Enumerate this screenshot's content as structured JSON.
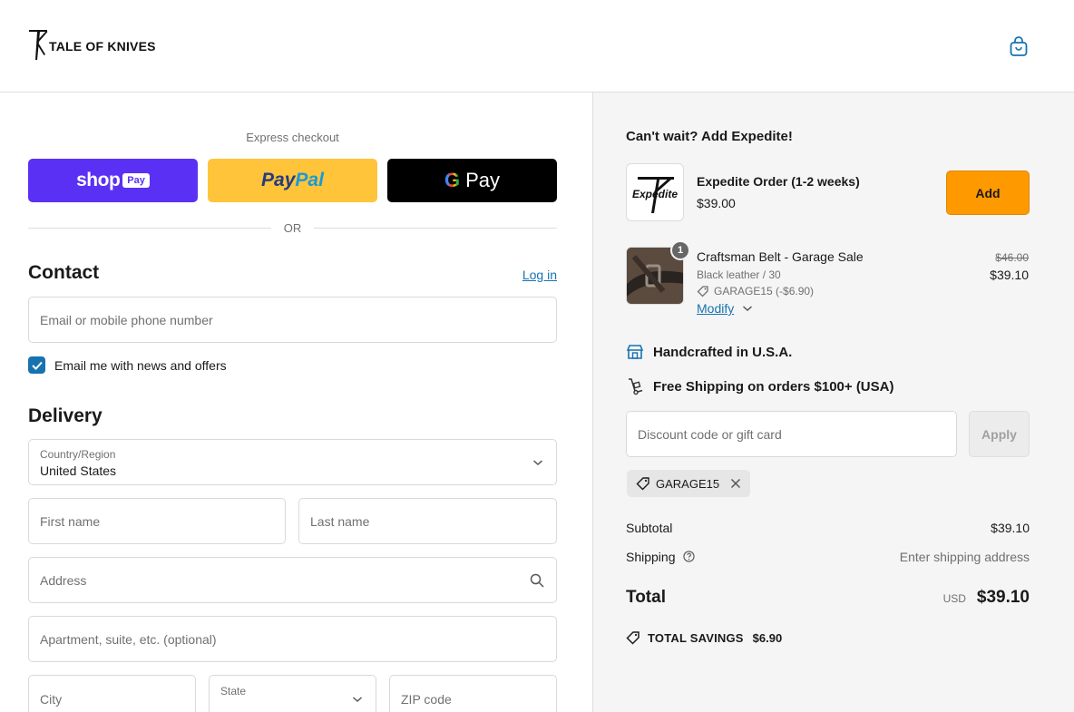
{
  "brand": {
    "name": "TALE OF KNIVES"
  },
  "header": {
    "cart_icon": "shopping-bag-icon"
  },
  "express": {
    "label": "Express checkout",
    "shop_word": "shop",
    "shop_pay": "Pay",
    "paypal_1": "Pay",
    "paypal_2": "Pal",
    "gpay_g": "G",
    "gpay_word": "Pay",
    "or": "OR"
  },
  "contact": {
    "title": "Contact",
    "login": "Log in",
    "email_placeholder": "Email or mobile phone number",
    "newsletter_label": "Email me with news and offers",
    "newsletter_checked": true
  },
  "delivery": {
    "title": "Delivery",
    "country_label": "Country/Region",
    "country_value": "United States",
    "first_name": "First name",
    "last_name": "Last name",
    "address": "Address",
    "apartment": "Apartment, suite, etc. (optional)",
    "city": "City",
    "state": "State",
    "zip": "ZIP code"
  },
  "upsell": {
    "title": "Can't wait? Add Expedite!",
    "name": "Expedite Order (1-2 weeks)",
    "price": "$39.00",
    "thumb_text": "Expedite",
    "add": "Add"
  },
  "cart_item": {
    "quantity": "1",
    "name": "Craftsman Belt - Garage Sale",
    "variant": "Black leather / 30",
    "discount": "GARAGE15 (-$6.90)",
    "modify": "Modify",
    "old_price": "$46.00",
    "price": "$39.10"
  },
  "features": [
    {
      "icon": "store-icon",
      "text": "Handcrafted in U.S.A."
    },
    {
      "icon": "hand-truck-icon",
      "text": "Free Shipping on orders $100+ (USA)"
    }
  ],
  "discount": {
    "placeholder": "Discount code or gift card",
    "apply": "Apply",
    "applied_code": "GARAGE15"
  },
  "summary": {
    "subtotal_label": "Subtotal",
    "subtotal_value": "$39.10",
    "shipping_label": "Shipping",
    "shipping_value": "Enter shipping address",
    "total_label": "Total",
    "currency": "USD",
    "total_value": "$39.10",
    "savings_label": "TOTAL SAVINGS",
    "savings_value": "$6.90"
  },
  "colors": {
    "shop_pay": "#5a31f4",
    "paypal": "#ffc439",
    "gpay": "#000000",
    "link": "#1773b0",
    "add_button": "#ff9900"
  }
}
